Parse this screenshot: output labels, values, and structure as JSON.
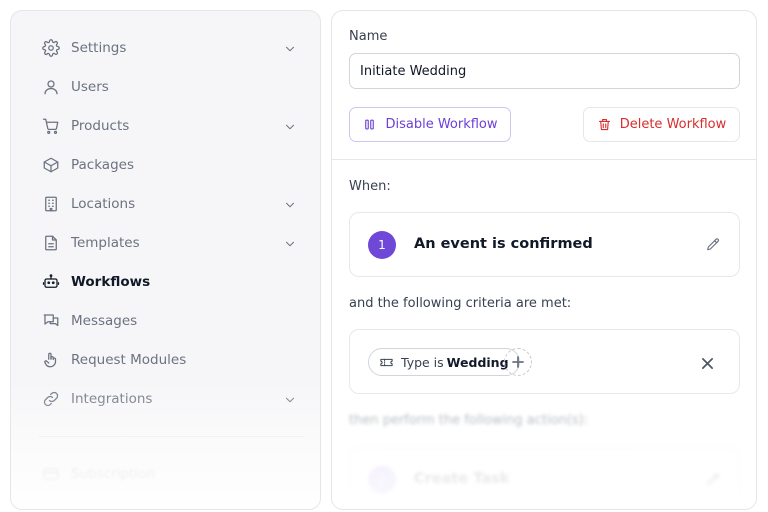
{
  "sidebar": {
    "items": [
      {
        "label": "Settings",
        "icon": "gear-icon",
        "has_chevron": true
      },
      {
        "label": "Users",
        "icon": "user-icon",
        "has_chevron": false
      },
      {
        "label": "Products",
        "icon": "cart-icon",
        "has_chevron": true
      },
      {
        "label": "Packages",
        "icon": "package-icon",
        "has_chevron": false
      },
      {
        "label": "Locations",
        "icon": "building-icon",
        "has_chevron": true
      },
      {
        "label": "Templates",
        "icon": "document-icon",
        "has_chevron": true
      },
      {
        "label": "Workflows",
        "icon": "robot-icon",
        "has_chevron": false,
        "active": true
      },
      {
        "label": "Messages",
        "icon": "chat-bubbles-icon",
        "has_chevron": false
      },
      {
        "label": "Request Modules",
        "icon": "hand-pointer-icon",
        "has_chevron": false
      },
      {
        "label": "Integrations",
        "icon": "link-icon",
        "has_chevron": true
      },
      {
        "label": "Subscription",
        "icon": "credit-card-icon",
        "has_chevron": false
      }
    ]
  },
  "workflow": {
    "name_label": "Name",
    "name_value": "Initiate Wedding",
    "disable_label": "Disable Workflow",
    "delete_label": "Delete Workflow",
    "when_label": "When:",
    "trigger": {
      "step": "1",
      "title": "An event is confirmed"
    },
    "criteria_label": "and the following criteria are met:",
    "criteria_chip": {
      "prefix": "Type is",
      "value": "Wedding"
    },
    "actions_label": "then perform the following action(s):",
    "action": {
      "step": "2",
      "title": "Create Task"
    }
  },
  "colors": {
    "accent": "#7048d8",
    "danger": "#d92d2d",
    "sidebar_bg": "#f6f6f8"
  }
}
